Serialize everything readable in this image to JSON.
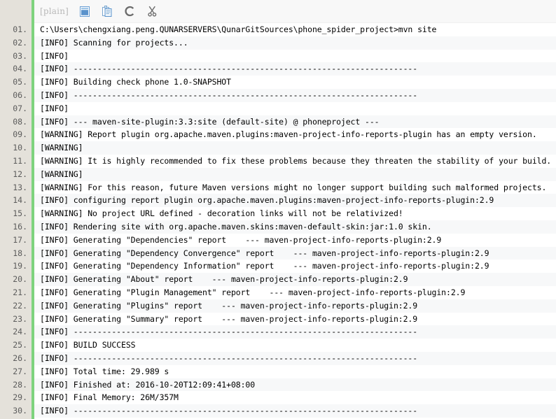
{
  "toolbar": {
    "label": "[plain]",
    "icons": [
      {
        "name": "view-window-icon",
        "title": "view"
      },
      {
        "name": "copy-clipboard-icon",
        "title": "copy"
      },
      {
        "name": "refresh-arrow-icon",
        "title": "refresh"
      },
      {
        "name": "cut-scissors-icon",
        "title": "cut"
      }
    ]
  },
  "colors": {
    "gutter_bg": "#e4e1da",
    "divider_green": "#7ed37e",
    "row_odd": "#ffffff",
    "row_even": "#f7f8f9",
    "toolbar_bg": "#f8f8f8",
    "text": "#000000",
    "lineno_text": "#5c5c5c",
    "toolbar_label": "#b9b9b9"
  },
  "code": {
    "language": "plain",
    "line_number_suffix": ".",
    "total_lines_visible": 30,
    "lines": [
      {
        "n": "01.",
        "text": "C:\\Users\\chengxiang.peng.QUNARSERVERS\\QunarGitSources\\phone_spider_project>mvn site"
      },
      {
        "n": "02.",
        "text": "[INFO] Scanning for projects..."
      },
      {
        "n": "03.",
        "text": "[INFO]"
      },
      {
        "n": "04.",
        "text": "[INFO] ------------------------------------------------------------------------"
      },
      {
        "n": "05.",
        "text": "[INFO] Building check phone 1.0-SNAPSHOT"
      },
      {
        "n": "06.",
        "text": "[INFO] ------------------------------------------------------------------------"
      },
      {
        "n": "07.",
        "text": "[INFO]"
      },
      {
        "n": "08.",
        "text": "[INFO] --- maven-site-plugin:3.3:site (default-site) @ phoneproject ---"
      },
      {
        "n": "09.",
        "text": "[WARNING] Report plugin org.apache.maven.plugins:maven-project-info-reports-plugin has an empty version."
      },
      {
        "n": "10.",
        "text": "[WARNING]"
      },
      {
        "n": "11.",
        "text": "[WARNING] It is highly recommended to fix these problems because they threaten the stability of your build."
      },
      {
        "n": "12.",
        "text": "[WARNING]"
      },
      {
        "n": "13.",
        "text": "[WARNING] For this reason, future Maven versions might no longer support building such malformed projects."
      },
      {
        "n": "14.",
        "text": "[INFO] configuring report plugin org.apache.maven.plugins:maven-project-info-reports-plugin:2.9"
      },
      {
        "n": "15.",
        "text": "[WARNING] No project URL defined - decoration links will not be relativized!"
      },
      {
        "n": "16.",
        "text": "[INFO] Rendering site with org.apache.maven.skins:maven-default-skin:jar:1.0 skin."
      },
      {
        "n": "17.",
        "text": "[INFO] Generating \"Dependencies\" report    --- maven-project-info-reports-plugin:2.9"
      },
      {
        "n": "18.",
        "text": "[INFO] Generating \"Dependency Convergence\" report    --- maven-project-info-reports-plugin:2.9"
      },
      {
        "n": "19.",
        "text": "[INFO] Generating \"Dependency Information\" report    --- maven-project-info-reports-plugin:2.9"
      },
      {
        "n": "20.",
        "text": "[INFO] Generating \"About\" report    --- maven-project-info-reports-plugin:2.9"
      },
      {
        "n": "21.",
        "text": "[INFO] Generating \"Plugin Management\" report    --- maven-project-info-reports-plugin:2.9"
      },
      {
        "n": "22.",
        "text": "[INFO] Generating \"Plugins\" report    --- maven-project-info-reports-plugin:2.9"
      },
      {
        "n": "23.",
        "text": "[INFO] Generating \"Summary\" report    --- maven-project-info-reports-plugin:2.9"
      },
      {
        "n": "24.",
        "text": "[INFO] ------------------------------------------------------------------------"
      },
      {
        "n": "25.",
        "text": "[INFO] BUILD SUCCESS"
      },
      {
        "n": "26.",
        "text": "[INFO] ------------------------------------------------------------------------"
      },
      {
        "n": "27.",
        "text": "[INFO] Total time: 29.989 s"
      },
      {
        "n": "28.",
        "text": "[INFO] Finished at: 2016-10-20T12:09:41+08:00"
      },
      {
        "n": "29.",
        "text": "[INFO] Final Memory: 26M/357M"
      },
      {
        "n": "30.",
        "text": "[INFO] ------------------------------------------------------------------------"
      }
    ]
  }
}
